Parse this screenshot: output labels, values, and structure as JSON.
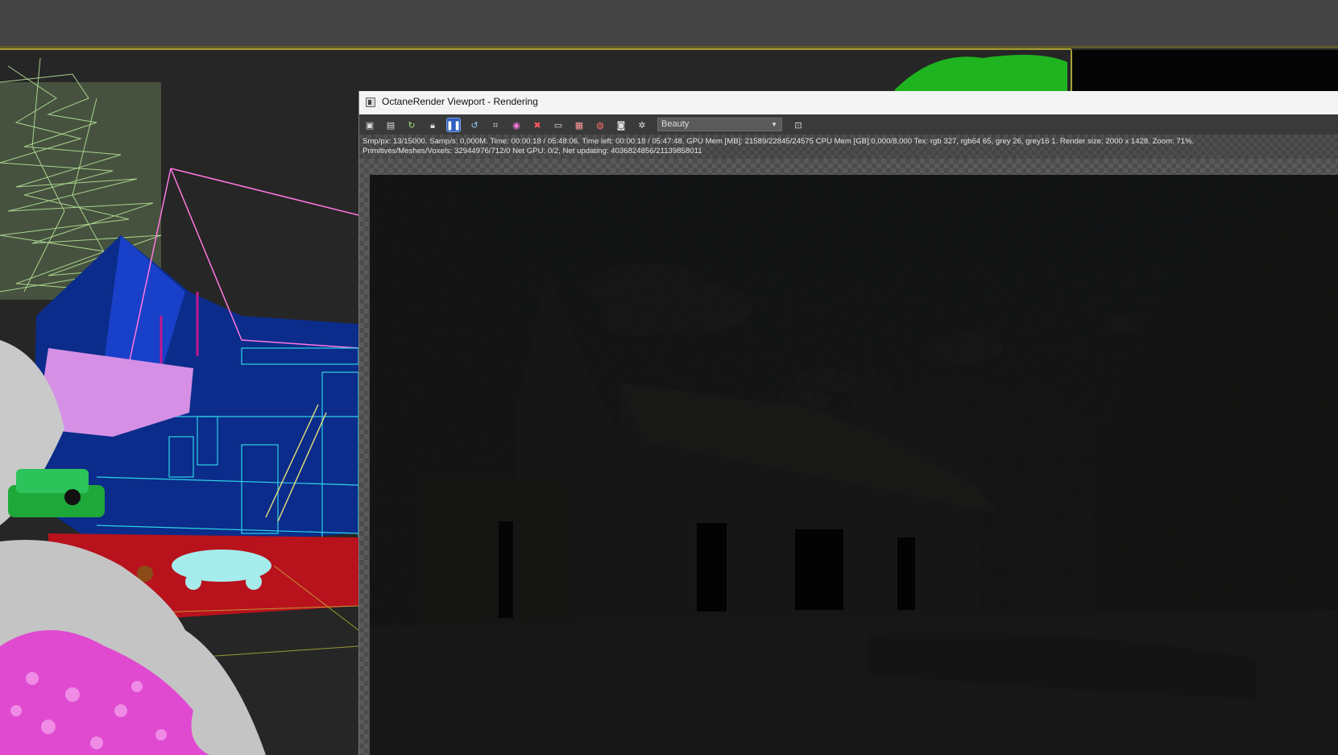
{
  "octane_window": {
    "title": "OctaneRender Viewport - Rendering",
    "render_pass": "Beauty",
    "status": {
      "line1": "Smp/px: 13/15000.   Samp/s: 0,000M.   Time: 00:00:18 / 05:48:06.   Time left: 00:00:18 / 05:47:48.   GPU Mem [MB]: 21589/22845/24575   CPU Mem [GB]:0,000/8,000   Tex: rgb 327, rgb64 65, grey 26, grey16 1.   Render size: 2000 x 1428.   Zoom: 71%.",
      "line2": "Primitives/Meshes/Voxels: 32944976/712/0   Net GPU: 0/2, Net updating: 4036824856/21139858011"
    },
    "toolbar_icons": [
      "save-image-icon",
      "copy-icon",
      "restart-render-icon",
      "lock-icon",
      "pause-icon",
      "refresh-icon",
      "region-render-icon",
      "color-picker-icon",
      "clear-icon",
      "display-icon",
      "film-icon",
      "record-icon",
      "camera-icon",
      "settings-icon",
      "expand-icon"
    ]
  },
  "colors": {
    "title_bar": "#f4f4f4",
    "toolbar": "#3a3a3a",
    "active_button": "#2f5fbf",
    "host_background": "#444444"
  }
}
